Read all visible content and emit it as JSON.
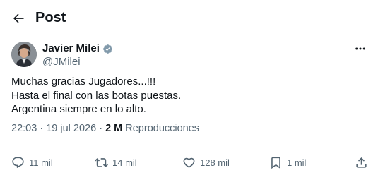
{
  "header": {
    "title": "Post"
  },
  "author": {
    "name": "Javier Milei",
    "handle": "@JMilei",
    "verified_color": "#829aab"
  },
  "tweet": {
    "lines": [
      "Muchas gracias Jugadores...!!!",
      "Hasta el final con las botas puestas.",
      "Argentina siempre en lo alto."
    ]
  },
  "meta": {
    "time": "22:03",
    "separator": "·",
    "date": "19 jul 2026",
    "views_count": "2 M",
    "views_label": "Reproducciones"
  },
  "actions": {
    "replies": "11 mil",
    "reposts": "14 mil",
    "likes": "128 mil",
    "bookmarks": "1 mil"
  },
  "colors": {
    "text": "#0f1419",
    "secondary": "#536471",
    "divider": "#eff3f4"
  }
}
